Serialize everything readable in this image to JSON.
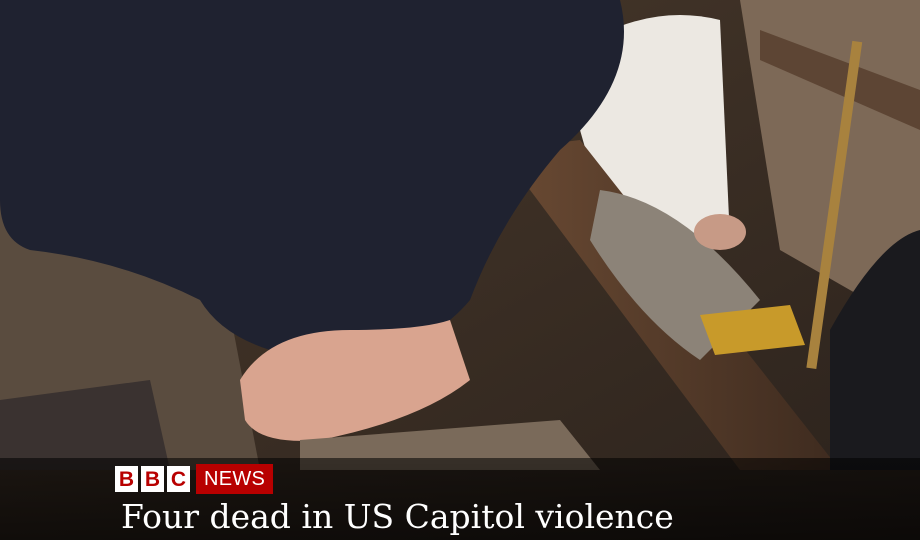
{
  "broadcaster": {
    "logo_letters": [
      "B",
      "B",
      "C"
    ],
    "logo_suffix": "NEWS",
    "logo_icon": "bbc-news-logo",
    "brand_color": "#b80000"
  },
  "caption": {
    "headline": "Four dead in US Capitol violence"
  }
}
